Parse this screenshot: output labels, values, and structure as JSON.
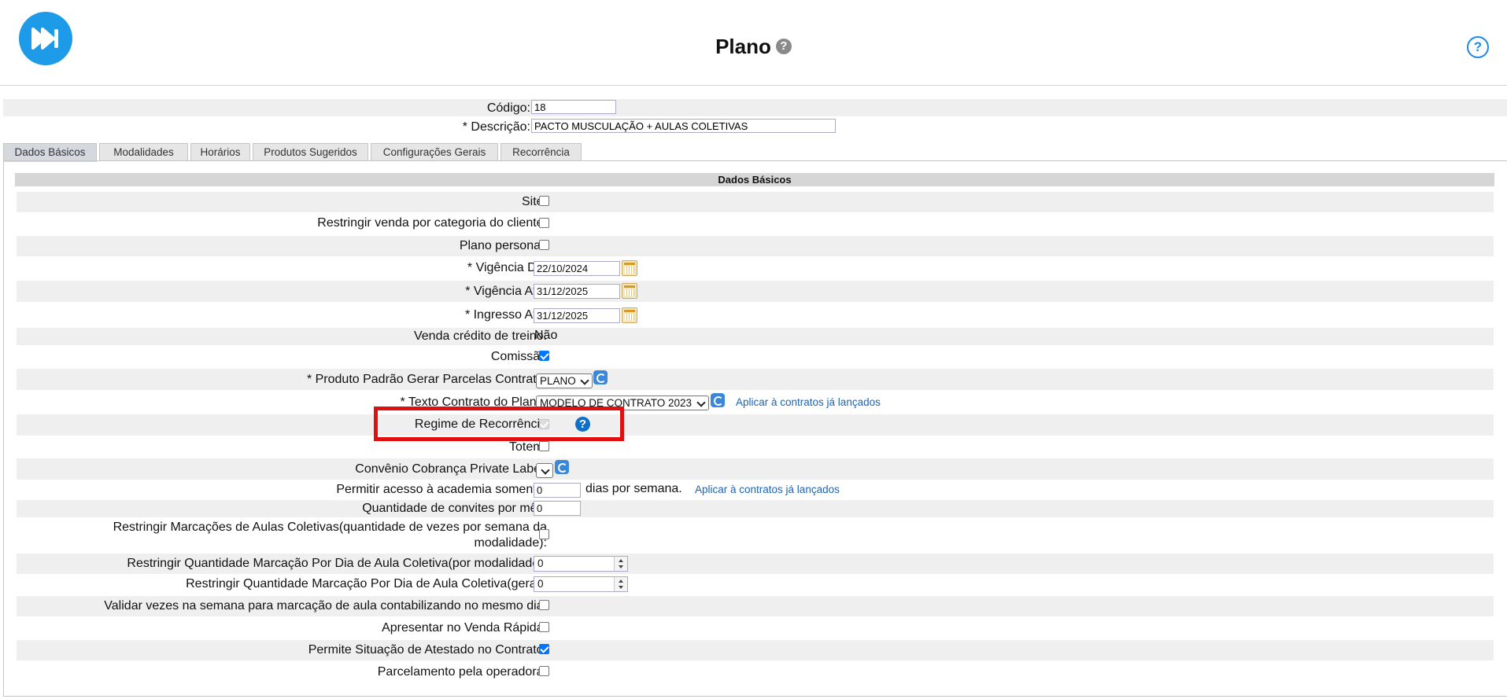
{
  "header": {
    "title": "Plano",
    "title_help_icon": "question-circle-icon",
    "help_icon": "question-circle-icon",
    "logo": "fast-forward-logo"
  },
  "codigo": {
    "label": "Código:",
    "value": "18"
  },
  "descricao": {
    "label": "* Descrição:",
    "value": "PACTO MUSCULAÇÃO + AULAS COLETIVAS"
  },
  "tabs": [
    {
      "label": "Dados Básicos",
      "active": true
    },
    {
      "label": "Modalidades"
    },
    {
      "label": "Horários"
    },
    {
      "label": "Produtos Sugeridos"
    },
    {
      "label": "Configurações Gerais"
    },
    {
      "label": "Recorrência"
    }
  ],
  "section_title": "Dados Básicos",
  "fields": {
    "site": {
      "label": "Site:",
      "checked": false
    },
    "restringir_categoria": {
      "label": "Restringir venda por categoria do cliente:",
      "checked": false
    },
    "plano_personal": {
      "label": "Plano personal:",
      "checked": false
    },
    "vigencia_de": {
      "label": "* Vigência De:",
      "value": "22/10/2024"
    },
    "vigencia_ate": {
      "label": "* Vigência Até:",
      "value": "31/12/2025"
    },
    "ingresso_ate": {
      "label": "* Ingresso Até:",
      "value": "31/12/2025"
    },
    "venda_credito": {
      "label": "Venda crédito de treino:",
      "value": "Não"
    },
    "comissao": {
      "label": "Comissão",
      "checked": true
    },
    "produto_padrao": {
      "label": "* Produto Padrão Gerar Parcelas Contrato:",
      "value": "PLANO"
    },
    "texto_contrato": {
      "label": "* Texto Contrato do Plano:",
      "value": "MODELO DE CONTRATO 2023",
      "link": "Aplicar à contratos já lançados"
    },
    "regime_recorrencia": {
      "label": "Regime de Recorrência",
      "checked": true,
      "disabled": true
    },
    "totem": {
      "label": "Totem:",
      "checked": false
    },
    "convenio": {
      "label": "Convênio Cobrança Private Label:",
      "value": ""
    },
    "permitir_acesso": {
      "label": "Permitir acesso à academia somente:",
      "value": "0",
      "suffix": "dias por semana.",
      "link": "Aplicar à contratos já lançados"
    },
    "convites": {
      "label": "Quantidade de convites por mês:",
      "value": "0"
    },
    "restringir_marcacoes": {
      "label_line1": "Restringir Marcações de Aulas Coletivas(quantidade de vezes por semana da",
      "label_line2": "modalidade):",
      "checked": false
    },
    "restringir_por_modalidade": {
      "label": "Restringir Quantidade Marcação Por Dia de Aula Coletiva(por modalidade):",
      "value": "0"
    },
    "restringir_geral": {
      "label": "Restringir Quantidade Marcação Por Dia de Aula Coletiva(geral):",
      "value": "0"
    },
    "validar_vezes": {
      "label": "Validar vezes na semana para marcação de aula contabilizando no mesmo dia:",
      "checked": false
    },
    "venda_rapida": {
      "label": "Apresentar no Venda Rápida:",
      "checked": false
    },
    "atestado": {
      "label": "Permite Situação de Atestado no Contrato:",
      "checked": true
    },
    "parcelamento": {
      "label": "Parcelamento pela operadora:",
      "checked": false
    }
  },
  "colors": {
    "accent": "#1e9be8",
    "highlight": "#e10f0f",
    "link": "#1a64b8",
    "checkbox_checked": "#0075ff"
  }
}
